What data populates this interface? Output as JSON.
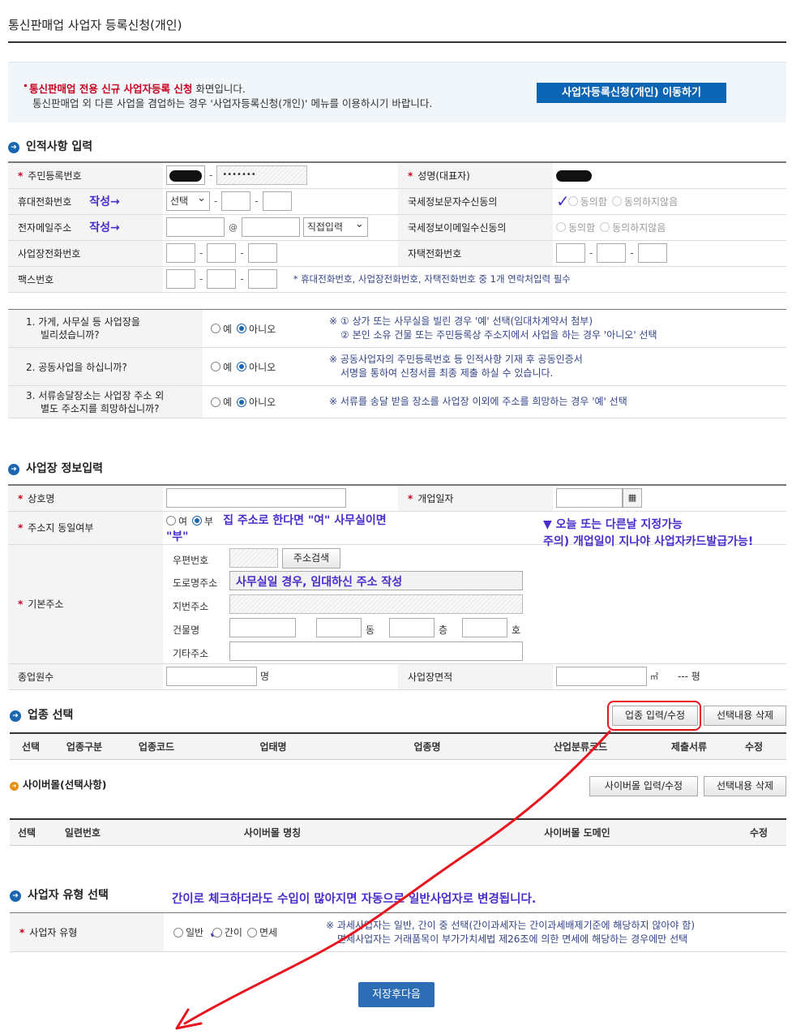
{
  "page": {
    "title": "통신판매업 사업자 등록신청(개인)"
  },
  "notice": {
    "line1_highlight": "통신판매업 전용 신규 사업자등록 신청",
    "line1_rest": " 화면입니다.",
    "line2": "통신판매업 외 다른 사업을 겸업하는 경우 '사업자등록신청(개인)'  메뉴를 이용하시기 바랍니다.",
    "move_button": "사업자등록신청(개인) 이동하기"
  },
  "personal": {
    "section_title": "인적사항 입력",
    "rrn_label": "주민등록번호",
    "rrn_masked": "•••••••",
    "name_label": "성명(대표자)",
    "mobile_label": "휴대전화번호",
    "mobile_select": "선택",
    "sms_consent_label": "국세정보문자수신동의",
    "agree": "동의함",
    "disagree": "동의하지않음",
    "email_label": "전자메일주소",
    "email_at": "@",
    "email_domain_select": "직접입력",
    "email_consent_label": "국세정보이메일수신동의",
    "biz_phone_label": "사업장전화번호",
    "home_phone_label": "자택전화번호",
    "fax_label": "팩스번호",
    "contact_note": "* 휴대전화번호, 사업장전화번호, 자택전화번호 중 1개 연락처입력 필수",
    "annotation_write": "작성→"
  },
  "questions": [
    {
      "label_line1": "1. 가게, 사무실 등 사업장을",
      "label_line2": "빌리셨습니까?",
      "yes": "예",
      "no": "아니오",
      "note1": "※ ① 상가 또는 사무실을 빌린 경우 '예' 선택(임대차계약서 첨부)",
      "note2": "② 본인 소유 건물 또는 주민등록상 주소지에서 사업을 하는 경우 '아니오' 선택"
    },
    {
      "label_line1": "2. 공동사업을 하십니까?",
      "label_line2": "",
      "yes": "예",
      "no": "아니오",
      "note1": "※ 공동사업자의 주민등록번호 등 인적사항 기재 후 공동인증서",
      "note2": "서명을 통하여 신청서를 최종 제출 하실 수 있습니다."
    },
    {
      "label_line1": "3. 서류송달장소는 사업장 주소 외",
      "label_line2": "별도 주소지를 희망하십니까?",
      "yes": "예",
      "no": "아니오",
      "note1": "※ 서류를 송달 받을 장소를 사업장 이외에 주소를 희망하는 경우 '예' 선택",
      "note2": ""
    }
  ],
  "business": {
    "section_title": "사업장 정보입력",
    "trade_name_label": "상호명",
    "open_date_label": "개업일자",
    "same_address_label": "주소지 동일여부",
    "yes": "여",
    "no": "부",
    "anno_same_address": "집 주소로 한다면 \"여\" 사무실이면 \"부\"",
    "anno_open_date1": "▼ 오늘 또는 다른날 지정가능",
    "anno_open_date2": "주의) 개업일이 지나야 사업자카드발급가능!",
    "base_address_label": "기본주소",
    "postal_label": "우편번호",
    "address_search_button": "주소검색",
    "road_label": "도로명주소",
    "road_anno": "사무실일 경우, 임대하신 주소 작성",
    "lot_label": "지번주소",
    "building_label": "건물명",
    "dong": "동",
    "floor": "층",
    "ho": "호",
    "other_label": "기타주소",
    "employees_label": "종업원수",
    "employees_unit": "명",
    "area_label": "사업장면적",
    "area_unit": "㎡",
    "area_pyeong": "--- 평"
  },
  "industry": {
    "section_title": "업종 선택",
    "input_button": "업종 입력/수정",
    "delete_button": "선택내용 삭제",
    "columns": [
      "선택",
      "업종구분",
      "업종코드",
      "업태명",
      "업종명",
      "산업분류코드",
      "제출서류",
      "수정"
    ]
  },
  "cybermall": {
    "section_title": "사이버몰(선택사항)",
    "input_button": "사이버몰 입력/수정",
    "delete_button": "선택내용 삭제",
    "columns": [
      "선택",
      "일련번호",
      "사이버몰 명칭",
      "사이버몰 도메인",
      "수정"
    ]
  },
  "biztype": {
    "section_title": "사업자 유형 선택",
    "annotation": "간이로 체크하더라도 수입이 많아지면 자동으로 일반사업자로 변경됩니다.",
    "label": "사업자 유형",
    "general": "일반",
    "simple": "간이",
    "exempt": "면세",
    "note1": "※ 과세사업자는 일반, 간이 중 선택(간이과세자는 간이과세배제기준에 해당하지 않아야 함)",
    "note2": "면세사업자는 거래품목이 부가가치세법 제26조에 의한 면세에 해당하는 경우에만 선택"
  },
  "footer": {
    "save_button": "저장후다음"
  },
  "colors": {
    "primary": "#0b64b4",
    "required": "#c8001e",
    "annotation": "#4a2ccd",
    "red_mark": "#e8141e"
  }
}
